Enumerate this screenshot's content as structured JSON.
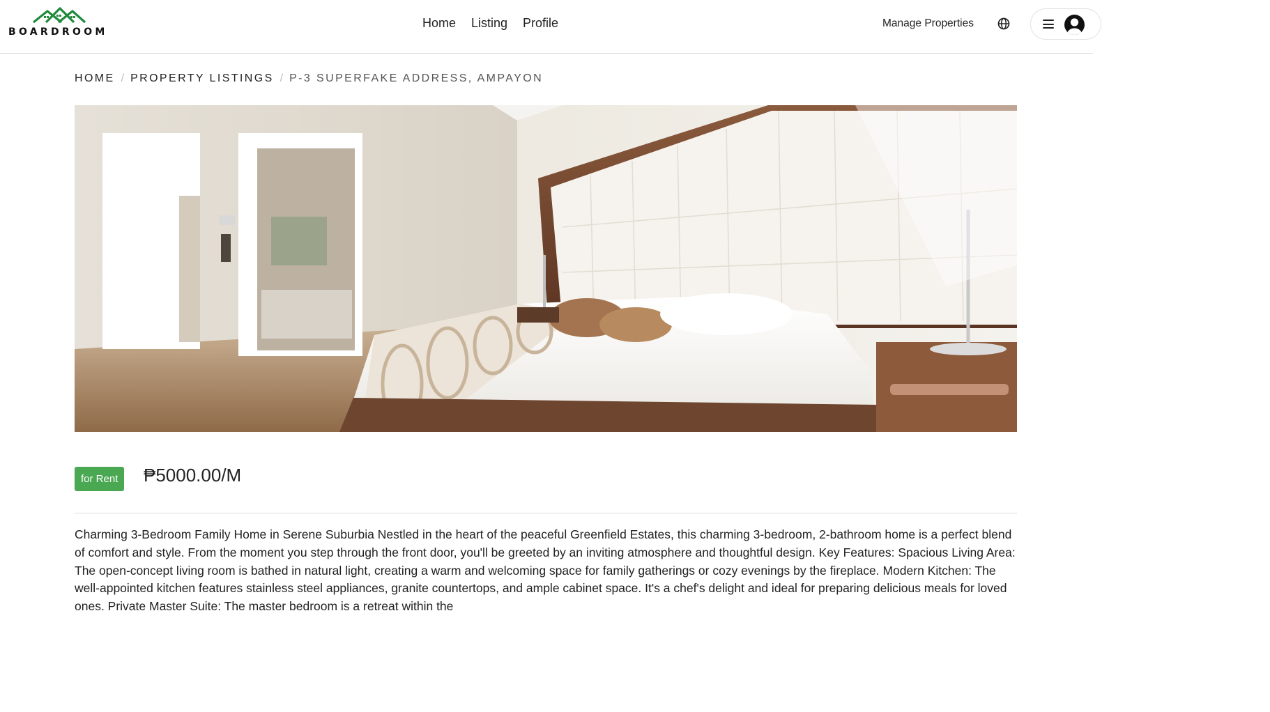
{
  "brand": {
    "name": "BOARDROOM",
    "accent": "#1f8a3b"
  },
  "nav": {
    "items": [
      "Home",
      "Listing",
      "Profile"
    ]
  },
  "header_actions": {
    "manage_label": "Manage Properties",
    "language_icon": "globe-icon",
    "menu_icon": "hamburger-icon",
    "avatar_icon": "user-avatar-icon"
  },
  "breadcrumb": {
    "items": [
      "HOME",
      "PROPERTY LISTINGS",
      "P-3 SUPERFAKE ADDRESS, AMPAYON"
    ],
    "separator": "/"
  },
  "listing": {
    "image_subject": "bright bedroom with white padded headboard, white bed, ensuite bathroom doorway",
    "status_badge": "for Rent",
    "status_color": "#4aa752",
    "price": "₱5000.00/M",
    "description": "Charming 3-Bedroom Family Home in Serene Suburbia Nestled in the heart of the peaceful Greenfield Estates, this charming 3-bedroom, 2-bathroom home is a perfect blend of comfort and style. From the moment you step through the front door, you'll be greeted by an inviting atmosphere and thoughtful design. Key Features: Spacious Living Area: The open-concept living room is bathed in natural light, creating a warm and welcoming space for family gatherings or cozy evenings by the fireplace. Modern Kitchen: The well-appointed kitchen features stainless steel appliances, granite countertops, and ample cabinet space. It's a chef's delight and ideal for preparing delicious meals for loved ones. Private Master Suite: The master bedroom is a retreat within the"
  }
}
